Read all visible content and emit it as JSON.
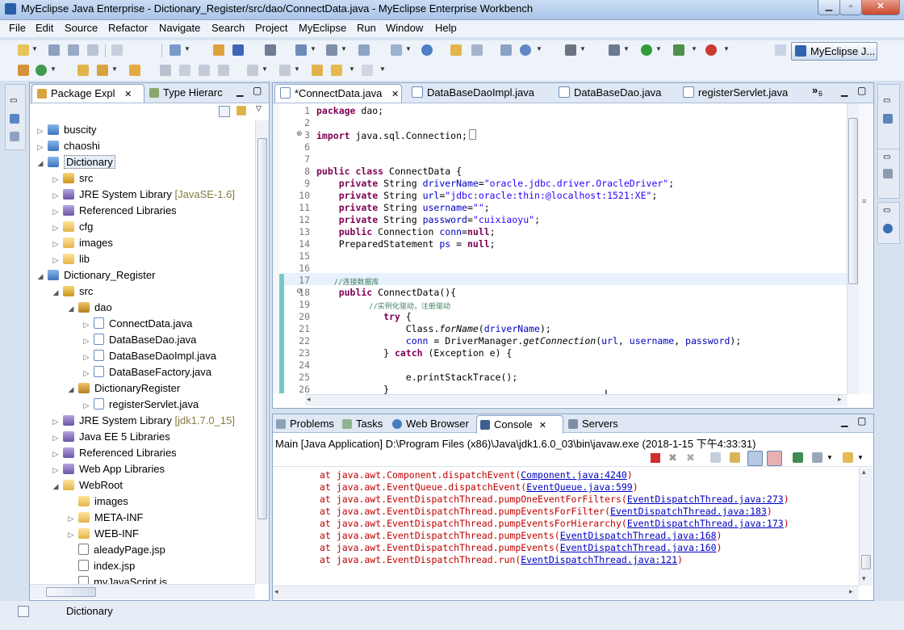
{
  "window": {
    "title": "MyEclipse Java Enterprise - Dictionary_Register/src/dao/ConnectData.java - MyEclipse Enterprise Workbench",
    "minimize": "▁",
    "maximize": "▫",
    "close": "✕"
  },
  "menu": [
    "File",
    "Edit",
    "Source",
    "Refactor",
    "Navigate",
    "Search",
    "Project",
    "MyEclipse",
    "Run",
    "Window",
    "Help"
  ],
  "perspective": {
    "label": "MyEclipse J..."
  },
  "explorer": {
    "tabs": [
      {
        "label": "Package Expl",
        "close": "✕"
      },
      {
        "label": "Type Hierarc"
      }
    ],
    "tree": [
      {
        "label": "buscity",
        "suffix": "",
        "twisty": "▷"
      },
      {
        "label": "chaoshi",
        "suffix": "",
        "twisty": "▷"
      },
      {
        "label": "Dictionary",
        "suffix": "",
        "twisty": "◢"
      },
      {
        "label": "src",
        "suffix": "",
        "twisty": "▷"
      },
      {
        "label": "JRE System Library",
        "suffix": "[JavaSE-1.6]",
        "twisty": "▷"
      },
      {
        "label": "Referenced Libraries",
        "suffix": "",
        "twisty": "▷"
      },
      {
        "label": "cfg",
        "suffix": "",
        "twisty": "▷"
      },
      {
        "label": "images",
        "suffix": "",
        "twisty": "▷"
      },
      {
        "label": "lib",
        "suffix": "",
        "twisty": "▷"
      },
      {
        "label": "Dictionary_Register",
        "suffix": "",
        "twisty": "◢"
      },
      {
        "label": "src",
        "suffix": "",
        "twisty": "◢"
      },
      {
        "label": "dao",
        "suffix": "",
        "twisty": "◢"
      },
      {
        "label": "ConnectData.java",
        "suffix": "",
        "twisty": "▷"
      },
      {
        "label": "DataBaseDao.java",
        "suffix": "",
        "twisty": "▷"
      },
      {
        "label": "DataBaseDaoImpl.java",
        "suffix": "",
        "twisty": "▷"
      },
      {
        "label": "DataBaseFactory.java",
        "suffix": "",
        "twisty": "▷"
      },
      {
        "label": "DictionaryRegister",
        "suffix": "",
        "twisty": "◢"
      },
      {
        "label": "registerServlet.java",
        "suffix": "",
        "twisty": "▷"
      },
      {
        "label": "JRE System Library",
        "suffix": "[jdk1.7.0_15]",
        "twisty": "▷"
      },
      {
        "label": "Java EE 5 Libraries",
        "suffix": "",
        "twisty": "▷"
      },
      {
        "label": "Referenced Libraries",
        "suffix": "",
        "twisty": "▷"
      },
      {
        "label": "Web App Libraries",
        "suffix": "",
        "twisty": "▷"
      },
      {
        "label": "WebRoot",
        "suffix": "",
        "twisty": "◢"
      },
      {
        "label": "images",
        "suffix": "",
        "twisty": ""
      },
      {
        "label": "META-INF",
        "suffix": "",
        "twisty": "▷"
      },
      {
        "label": "WEB-INF",
        "suffix": "",
        "twisty": "▷"
      },
      {
        "label": "aleadyPage.jsp",
        "suffix": "",
        "twisty": ""
      },
      {
        "label": "index.jsp",
        "suffix": "",
        "twisty": ""
      },
      {
        "label": "myJavaScript.js",
        "suffix": "",
        "twisty": ""
      }
    ]
  },
  "editor": {
    "tabs": [
      {
        "label": "*ConnectData.java",
        "close": "✕"
      },
      {
        "label": "DataBaseDaoImpl.java"
      },
      {
        "label": "DataBaseDao.java"
      },
      {
        "label": "registerServlet.java"
      }
    ],
    "overflow": "»",
    "overflow_count": "6",
    "line_numbers": [
      "1",
      "2",
      "3",
      "6",
      "7",
      "8",
      "9",
      "10",
      "11",
      "12",
      "13",
      "14",
      "15",
      "16",
      "17",
      "18",
      "19",
      "20",
      "21",
      "22",
      "23",
      "24",
      "25",
      "26"
    ],
    "fold_import": "⊕",
    "fold_ctor": "⊖",
    "code": {
      "l1_kw": "package",
      "l1_rest": " dao;",
      "l3_kw": "import",
      "l3_rest": " java.sql.Connection;",
      "l8_kw": "public class",
      "l8_rest": " ConnectData {",
      "l9_a": "    private",
      "l9_b": " String ",
      "l9_f": "driverName",
      "l9_c": "=",
      "l9_s": "\"oracle.jdbc.driver.OracleDriver\"",
      "l9_d": ";",
      "l10_a": "    private",
      "l10_b": " String ",
      "l10_f": "url",
      "l10_c": "=",
      "l10_s": "\"jdbc:oracle:thin:@localhost:1521:XE\"",
      "l10_d": ";",
      "l11_a": "    private",
      "l11_b": " String ",
      "l11_f": "username",
      "l11_c": "=",
      "l11_s": "\"\"",
      "l11_d": ";",
      "l12_a": "    private",
      "l12_b": " String ",
      "l12_f": "password",
      "l12_c": "=",
      "l12_s": "\"cuixiaoyu\"",
      "l12_d": ";",
      "l13_a": "    public",
      "l13_b": " Connection ",
      "l13_f": "conn",
      "l13_c": "=",
      "l13_k": "null",
      "l13_d": ";",
      "l14_a": "    PreparedStatement ",
      "l14_f": "ps",
      "l14_c": " = ",
      "l14_k": "null",
      "l14_d": ";",
      "l17_cmt": "    //连接数据库",
      "l18_a": "    public",
      "l18_rest": " ConnectData(){",
      "l19_cmt": "            //实例化驱动，注册驱动",
      "l20_a": "            try",
      "l20_rest": " {",
      "l21_a": "                Class.",
      "l21_m": "forName",
      "l21_b": "(",
      "l21_f": "driverName",
      "l21_c": ");",
      "l22_a": "                ",
      "l22_f": "conn",
      "l22_b": " = DriverManager.",
      "l22_m": "getConnection",
      "l22_c": "(",
      "l22_f1": "url",
      "l22_d": ", ",
      "l22_f2": "username",
      "l22_e": ", ",
      "l22_f3": "password",
      "l22_g": ");",
      "l23_a": "            } ",
      "l23_k": "catch",
      "l23_rest": " (Exception e) {",
      "l25_a": "                e.printStackTrace();",
      "l26_a": "            }"
    }
  },
  "bottom": {
    "tabs": [
      {
        "label": "Problems"
      },
      {
        "label": "Tasks"
      },
      {
        "label": "Web Browser"
      },
      {
        "label": "Console",
        "close": "✕"
      },
      {
        "label": "Servers"
      }
    ],
    "console_header": "Main [Java Application] D:\\Program Files (x86)\\Java\\jdk1.6.0_03\\bin\\javaw.exe (2018-1-15 下午4:33:31)",
    "lines": [
      {
        "text": "at java.awt.Component.dispatchEvent(",
        "link": "Component.java:4240",
        "end": ")"
      },
      {
        "text": "at java.awt.EventQueue.dispatchEvent(",
        "link": "EventQueue.java:599",
        "end": ")"
      },
      {
        "text": "at java.awt.EventDispatchThread.pumpOneEventForFilters(",
        "link": "EventDispatchThread.java:273",
        "end": ")"
      },
      {
        "text": "at java.awt.EventDispatchThread.pumpEventsForFilter(",
        "link": "EventDispatchThread.java:183",
        "end": ")"
      },
      {
        "text": "at java.awt.EventDispatchThread.pumpEventsForHierarchy(",
        "link": "EventDispatchThread.java:173",
        "end": ")"
      },
      {
        "text": "at java.awt.EventDispatchThread.pumpEvents(",
        "link": "EventDispatchThread.java:168",
        "end": ")"
      },
      {
        "text": "at java.awt.EventDispatchThread.pumpEvents(",
        "link": "EventDispatchThread.java:160",
        "end": ")"
      },
      {
        "text": "at java.awt.EventDispatchThread.run(",
        "link": "EventDispatchThread.java:121",
        "end": ")"
      }
    ]
  },
  "status": {
    "selection": "Dictionary"
  },
  "colors": {
    "keyword": "#7f0055",
    "string": "#2a00ff",
    "field": "#0000c0",
    "comment": "#3f7f5f",
    "console_error": "#c00000"
  }
}
